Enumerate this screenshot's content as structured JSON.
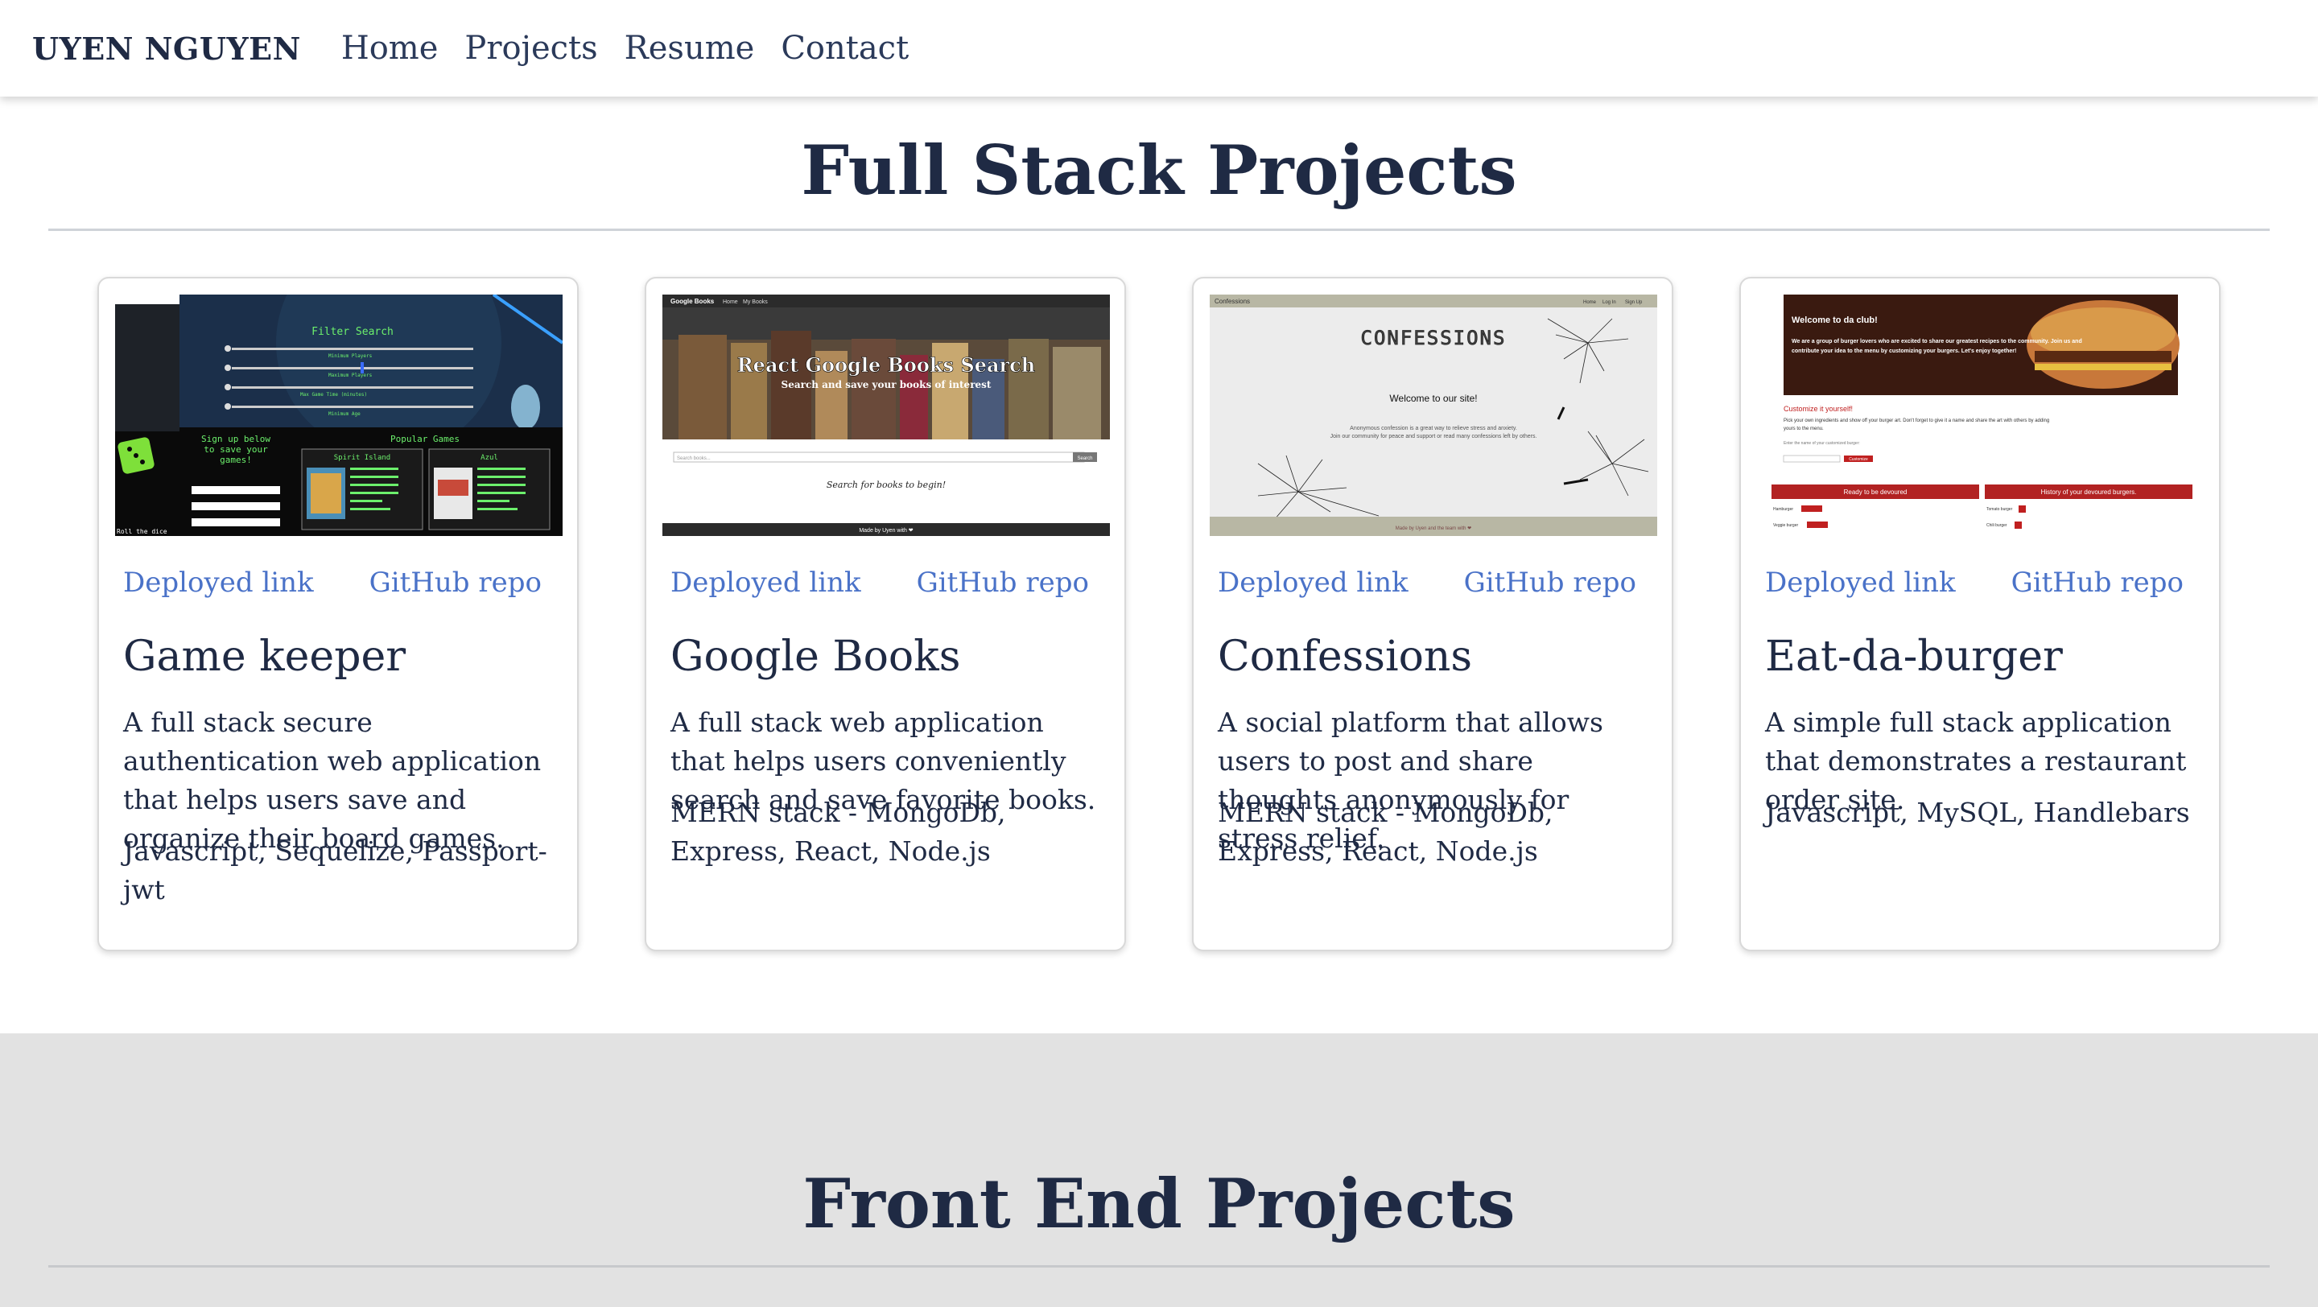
{
  "nav": {
    "brand": "UYEN NGUYEN",
    "links": [
      "Home",
      "Projects",
      "Resume",
      "Contact"
    ]
  },
  "full_stack": {
    "title": "Full Stack Projects",
    "cards": [
      {
        "deployed_label": "Deployed link",
        "repo_label": "GitHub repo",
        "title": "Game keeper",
        "description": "A full stack secure authentication web application that helps users save and organize their board games.",
        "tech": "Javascript, Sequelize, Passport-jwt",
        "thumb": {
          "filter_title": "Filter Search",
          "filters": [
            "Minimum Players",
            "Maximum Players",
            "Max Game Time (minutes)",
            "Minimum Age"
          ],
          "signup_text": "Sign up below to save your games!",
          "popular_title": "Popular Games",
          "games": [
            "Spirit Island",
            "Azul"
          ],
          "roll_text": "Roll the dice"
        }
      },
      {
        "deployed_label": "Deployed link",
        "repo_label": "GitHub repo",
        "title": "Google Books",
        "description": "A full stack web application that helps users conveniently search and save favorite books.",
        "tech": "MERN stack - MongoDb, Express, React, Node.js",
        "thumb": {
          "nav_brand": "Google Books",
          "nav_links": [
            "Home",
            "My Books"
          ],
          "hero_title": "React Google Books Search",
          "hero_sub": "Search and save your books of interest",
          "search_placeholder": "Search books...",
          "search_button": "Search",
          "empty_text": "Search for books to begin!",
          "footer": "Made by Uyen with ❤"
        }
      },
      {
        "deployed_label": "Deployed link",
        "repo_label": "GitHub repo",
        "title": "Confessions",
        "description": "A social platform that allows users to post and share thoughts anonymously for stress relief.",
        "tech": "MERN stack - MongoDb, Express, React, Node.js",
        "thumb": {
          "nav_brand": "Confessions",
          "nav_links": [
            "Home",
            "Log In",
            "Sign Up"
          ],
          "logo_text": "CONFESSIONS",
          "welcome": "Welcome to our site!",
          "blurb": "Anonymous confession is a great way to relieve stress and anxiety. Join our community for peace and support or read many confessions left by others.",
          "footer": "Made by Uyen and the team with ❤"
        }
      },
      {
        "deployed_label": "Deployed link",
        "repo_label": "GitHub repo",
        "title": "Eat-da-burger",
        "description": "A simple full stack application that demonstrates a restaurant order site.",
        "tech": "Javascript, MySQL, Handlebars",
        "thumb": {
          "hero_title": "Welcome to da club!",
          "hero_text": "We are a group of burger lovers who are excited to share our greatest recipes to the community. Join us and contribute your idea to the menu by customizing your burgers. Let's enjoy together!",
          "customize_title": "Customize it yourself!",
          "customize_text": "Pick your own ingredients and show off your burger art. Don't forget to give it a name and share the art with others by adding yours to the menu.",
          "input_label": "Enter the name of your customized burger:",
          "submit": "Customize",
          "col_left": "Ready to be devoured",
          "col_right": "History of your devoured burgers.",
          "left_items": [
            "Hamburger",
            "Veggie burger"
          ],
          "right_items": [
            "Tomato burger",
            "Chili burger"
          ],
          "devour": "Devour"
        }
      }
    ]
  },
  "front_end": {
    "title": "Front End Projects"
  }
}
